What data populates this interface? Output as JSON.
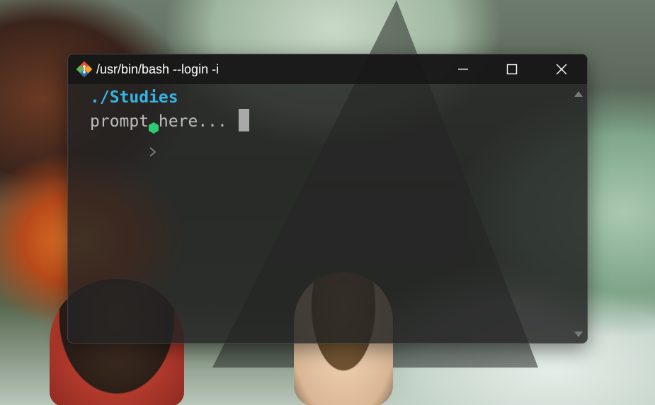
{
  "window": {
    "title": "/usr/bin/bash --login -i",
    "app_icon": "git-bash-icon"
  },
  "caption_buttons": {
    "minimize": "minimize-icon",
    "maximize": "maximize-icon",
    "close": "close-icon"
  },
  "terminal": {
    "cwd": "./Studies",
    "cwd_marker_icon": "hexagon-icon",
    "prompt_symbol_icon": "chevron-right-icon",
    "input_placeholder": "prompt here...",
    "colors": {
      "cwd": "#35b5e4",
      "hexagon": "#2ecc71",
      "prompt_text": "#bdbdbd",
      "cursor": "#a9a9a9",
      "background": "#222222"
    }
  },
  "scrollbar": {
    "up_icon": "scroll-up-arrow-icon",
    "down_icon": "scroll-down-arrow-icon"
  }
}
